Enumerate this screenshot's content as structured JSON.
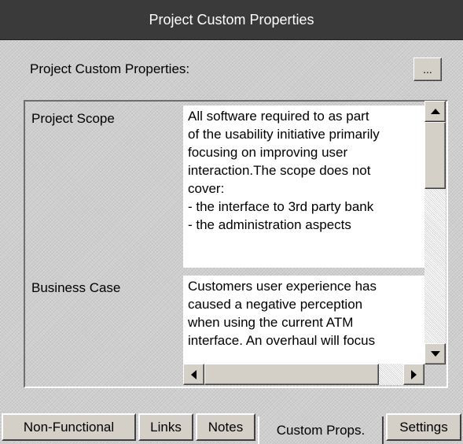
{
  "window": {
    "title": "Project Custom Properties"
  },
  "section": {
    "label": "Project Custom Properties:",
    "browse_label": "..."
  },
  "properties": [
    {
      "name": "Project Scope",
      "lines": [
        "All software required to as part",
        "of the usability initiative primarily",
        "focusing on improving user",
        "interaction.The scope does not",
        "cover:",
        "- the interface to 3rd party bank",
        "- the administration aspects"
      ]
    },
    {
      "name": "Business Case",
      "lines": [
        "Customers user experience has",
        "caused a negative perception",
        "when using the current ATM",
        "interface. An overhaul will focus"
      ]
    }
  ],
  "tabs": [
    {
      "label": "Non-Functional"
    },
    {
      "label": "Links"
    },
    {
      "label": "Notes"
    },
    {
      "label": "Custom Props."
    },
    {
      "label": "Settings"
    }
  ],
  "active_tab": "Custom Props.",
  "icons": {
    "scroll_up": "triangle-up-icon",
    "scroll_down": "triangle-down-icon",
    "scroll_left": "triangle-left-icon",
    "scroll_right": "triangle-right-icon"
  }
}
